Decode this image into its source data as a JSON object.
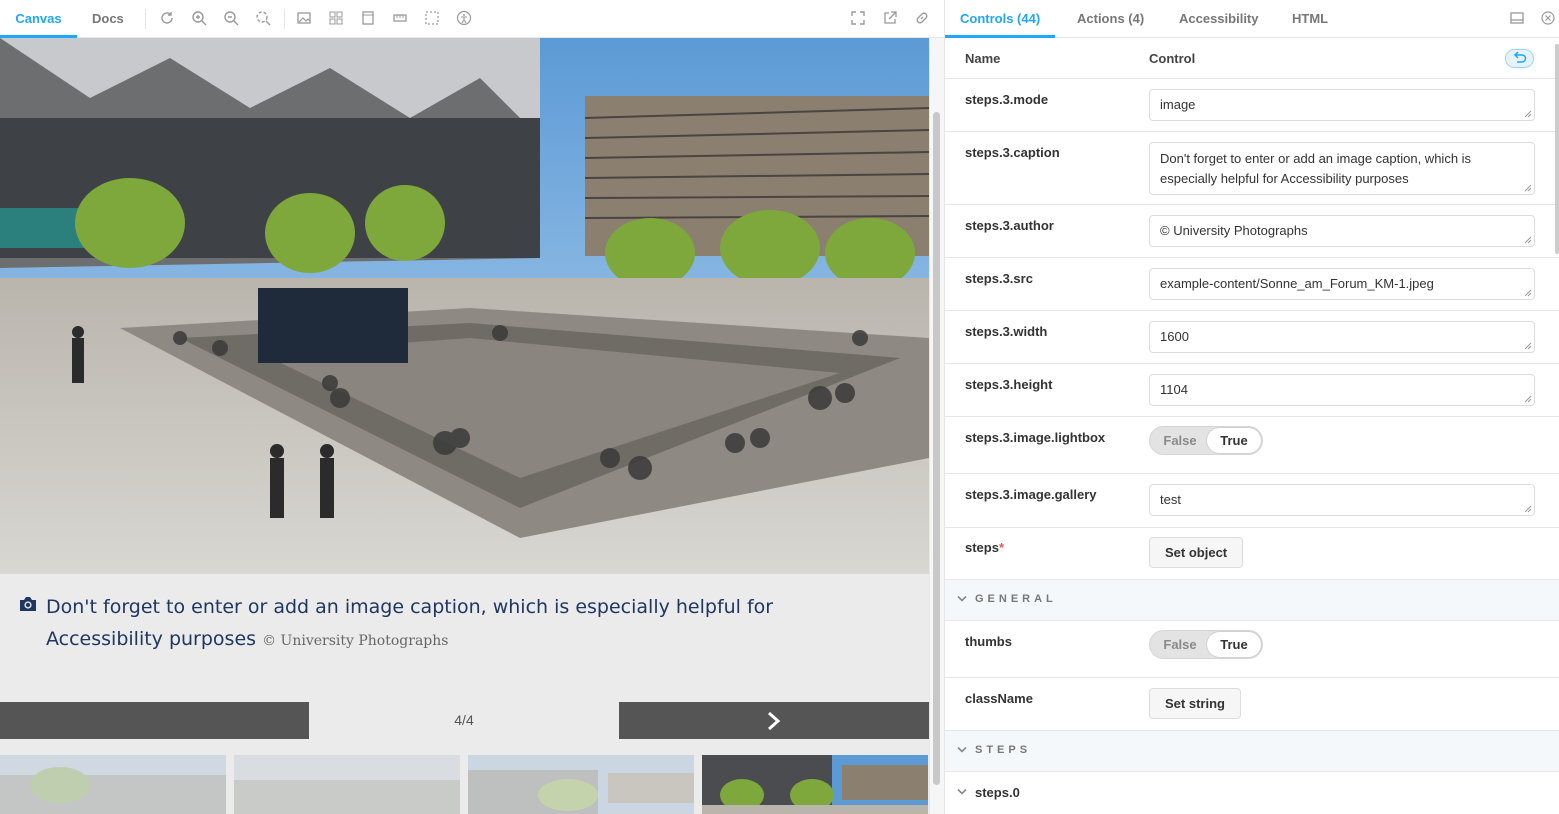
{
  "toolbar": {
    "tabs": [
      {
        "label": "Canvas",
        "active": true
      },
      {
        "label": "Docs",
        "active": false
      }
    ],
    "icons": [
      "reload-icon",
      "zoom-in-icon",
      "zoom-out-icon",
      "zoom-reset-icon",
      "background-icon",
      "grid-icon",
      "viewport-icon",
      "measure-icon",
      "outline-icon",
      "accessibility-icon"
    ],
    "right_icons": [
      "fullscreen-icon",
      "open-new-tab-icon",
      "copy-link-icon"
    ]
  },
  "canvas": {
    "caption": "Don't forget to enter or add an image caption, which is especially helpful for Accessibility purposes",
    "author": "© University Photographs",
    "pager_count": "4/4"
  },
  "panel": {
    "tabs": [
      {
        "label": "Controls (44)",
        "active": true
      },
      {
        "label": "Actions (4)",
        "active": false
      },
      {
        "label": "Accessibility",
        "active": false
      },
      {
        "label": "HTML",
        "active": false
      }
    ],
    "header": {
      "name": "Name",
      "control": "Control"
    },
    "rows": [
      {
        "name": "steps.3.mode",
        "value": "image"
      },
      {
        "name": "steps.3.caption",
        "value": "Don't forget to enter or add an image caption, which is especially helpful for Accessibility purposes"
      },
      {
        "name": "steps.3.author",
        "value": "© University Photographs"
      },
      {
        "name": "steps.3.src",
        "value": "example-content/Sonne_am_Forum_KM-1.jpeg"
      },
      {
        "name": "steps.3.width",
        "value": "1600"
      },
      {
        "name": "steps.3.height",
        "value": "1104"
      },
      {
        "name": "steps.3.image.lightbox",
        "false_label": "False",
        "true_label": "True"
      },
      {
        "name": "steps.3.image.gallery",
        "value": "test"
      },
      {
        "name": "steps",
        "button": "Set object"
      }
    ],
    "general": {
      "label": "GENERAL",
      "thumbs": {
        "name": "thumbs",
        "false_label": "False",
        "true_label": "True"
      },
      "classname": {
        "name": "className",
        "button": "Set string"
      }
    },
    "steps_section": {
      "label": "STEPS",
      "first": "steps.0"
    }
  }
}
